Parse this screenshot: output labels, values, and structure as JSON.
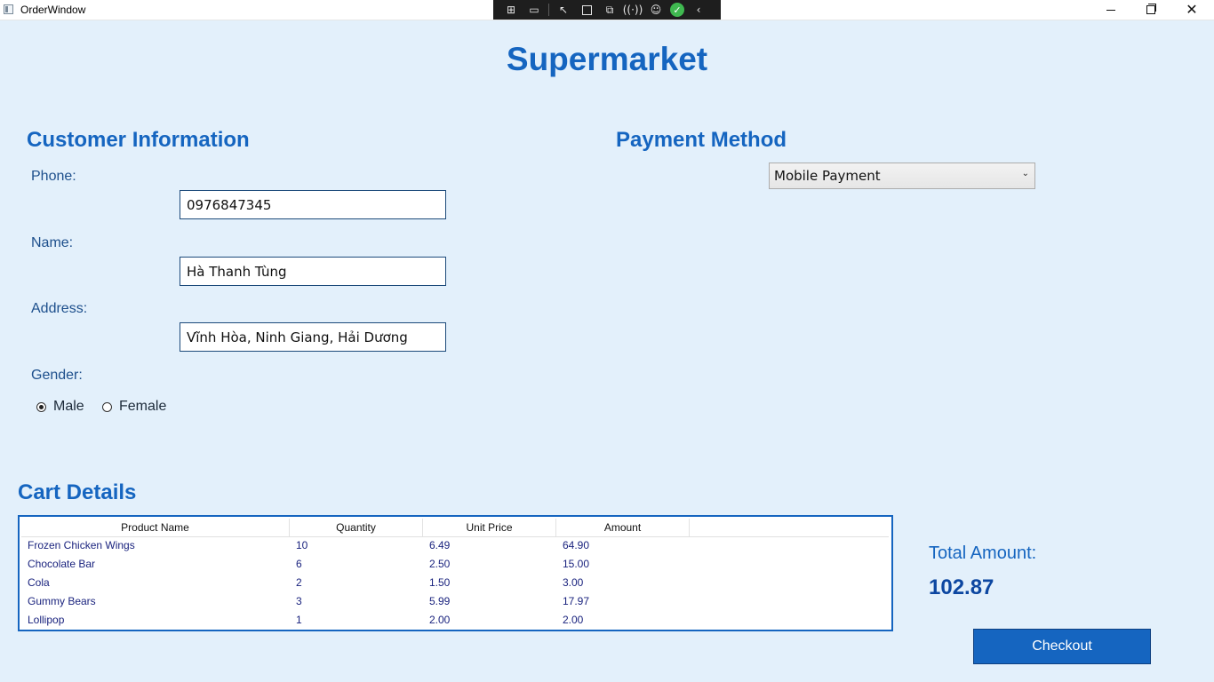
{
  "window": {
    "title": "OrderWindow"
  },
  "header": {
    "title": "Supermarket"
  },
  "customer": {
    "section_title": "Customer Information",
    "phone_label": "Phone:",
    "phone_value": "0976847345",
    "name_label": "Name:",
    "name_value": "Hà Thanh Tùng",
    "address_label": "Address:",
    "address_value": "Vĩnh Hòa, Ninh Giang, Hải Dương",
    "gender_label": "Gender:",
    "gender_options": [
      {
        "label": "Male",
        "checked": true
      },
      {
        "label": "Female",
        "checked": false
      }
    ]
  },
  "payment": {
    "section_title": "Payment Method",
    "selected": "Mobile Payment"
  },
  "cart": {
    "section_title": "Cart Details",
    "columns": [
      "Product Name",
      "Quantity",
      "Unit Price",
      "Amount"
    ],
    "rows": [
      [
        "Frozen Chicken Wings",
        "10",
        "6.49",
        "64.90"
      ],
      [
        "Chocolate Bar",
        "6",
        "2.50",
        "15.00"
      ],
      [
        "Cola",
        "2",
        "1.50",
        "3.00"
      ],
      [
        "Gummy Bears",
        "3",
        "5.99",
        "17.97"
      ],
      [
        "Lollipop",
        "1",
        "2.00",
        "2.00"
      ]
    ]
  },
  "summary": {
    "total_label": "Total Amount:",
    "total_value": "102.87",
    "checkout_label": "Checkout"
  }
}
